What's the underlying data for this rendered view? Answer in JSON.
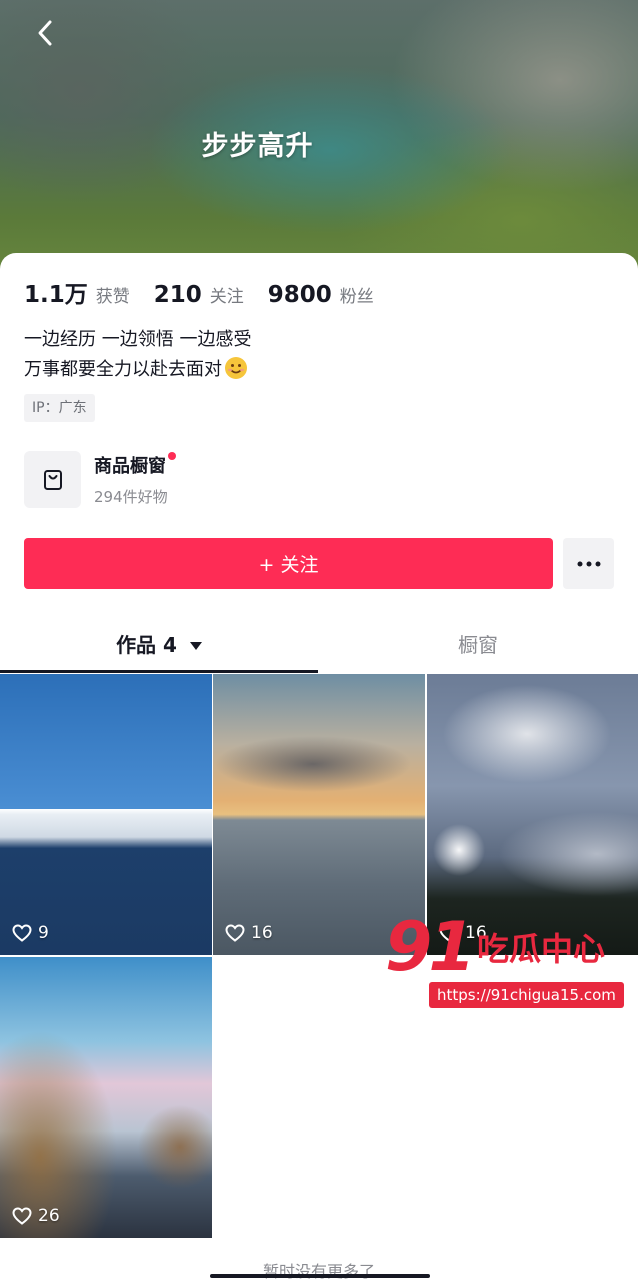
{
  "header": {
    "back_icon": "chevron-left-icon",
    "title": "步步高升"
  },
  "stats": [
    {
      "value": "1.1万",
      "label": "获赞"
    },
    {
      "value": "210",
      "label": "关注"
    },
    {
      "value": "9800",
      "label": "粉丝"
    }
  ],
  "bio": {
    "line1": "一边经历 一边领悟 一边感受",
    "line2": "万事都要全力以赴去面对",
    "emoji": "smile-emoji"
  },
  "ip_tag": "IP：广东",
  "shop": {
    "icon": "shopping-bag-icon",
    "title": "商品橱窗",
    "subtitle": "294件好物",
    "has_red_dot": true
  },
  "actions": {
    "follow_label": "+ 关注",
    "more_icon": "more-dots-icon"
  },
  "tabs": {
    "works_label": "作品 4",
    "works_dropdown_icon": "triangle-down-icon",
    "shop_label": "橱窗",
    "active": "works"
  },
  "videos": [
    {
      "likes": "9"
    },
    {
      "likes": "16"
    },
    {
      "likes": "16"
    },
    {
      "likes": "26"
    }
  ],
  "footer": {
    "no_more_text": "暂时没有更多了"
  },
  "watermark": {
    "logo_number": "91",
    "logo_text": "吃瓜中心",
    "url": "https://91chigua15.com"
  },
  "colors": {
    "accent": "#fe2c55",
    "text_primary": "#161823",
    "text_secondary": "#8a8b91"
  }
}
